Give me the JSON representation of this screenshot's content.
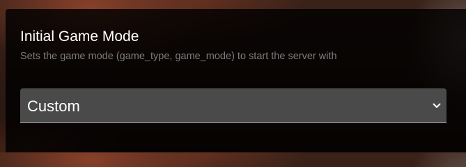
{
  "setting": {
    "title": "Initial Game Mode",
    "description": "Sets the game mode (game_type, game_mode) to start the server with",
    "select": {
      "selected": "Custom",
      "icon": "chevron-down-icon"
    }
  },
  "colors": {
    "panel_bg": "#000000",
    "select_bg": "#4a4a4a",
    "description_text": "#7d7d7d",
    "title_text": "#ffffff"
  }
}
